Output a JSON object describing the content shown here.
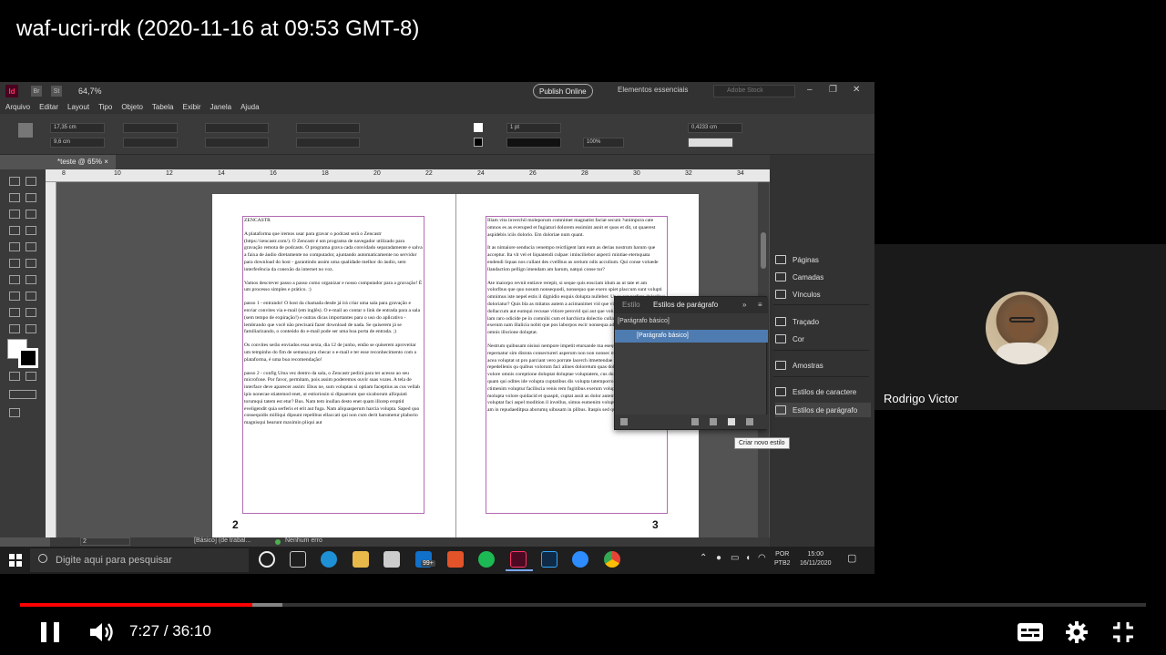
{
  "video": {
    "title": "waf-ucri-rdk (2020-11-16 at 09:53 GMT-8)",
    "current_time": "7:27",
    "duration": "36:10",
    "played_fraction": 0.206,
    "buffered_fraction": 0.233
  },
  "participant": {
    "name": "Rodrigo Victor"
  },
  "indesign": {
    "logo": "Id",
    "bridge_chip": "Br",
    "stock_chip": "St",
    "zoom": "64,7%",
    "publish_label": "Publish Online",
    "workspace": "Elementos essenciais",
    "search_placeholder": "Adobe Stock",
    "menu": [
      "Arquivo",
      "Editar",
      "Layout",
      "Tipo",
      "Objeto",
      "Tabela",
      "Exibir",
      "Janela",
      "Ajuda"
    ],
    "control": {
      "x": "17,35 cm",
      "y": "9,6 cm",
      "stroke": "1 pt",
      "scale": "100%",
      "gap": "0,4233 cm"
    },
    "doc_tab": "*teste @ 65%",
    "ruler_h": [
      "8",
      "10",
      "12",
      "14",
      "16",
      "18",
      "20",
      "22",
      "24",
      "26",
      "28",
      "30",
      "32",
      "34"
    ],
    "left_page": {
      "number": "2",
      "paragraphs": [
        "ZENCASTR",
        "A plataforma que iremos usar para gravar o podcast será o Zencastr (https://zencastr.com/). O Zencastr é um programa de navegador utilizado para gravação remota de podcasts. O programa grava cada convidado separadamente e salva a faixa de áudio diretamente no computador, ajuntando automaticamente no servidor para download do host - garantindo assim uma qualidade melhor do áudio, sem interferência da conexão da internet no voz.",
        "Vamos descrever passo a passo como organizar e nosso computador para a gravação! É um processo simples e prático. :)",
        "passo 1 - entrando! O host da chamada desde já irá criar uma sala para gravação e enviar convites via e-mail (em inglês). O e-mail ao contar o link de entrada para a sala (sem tempo de expiração!) e outras dicas importantes para o uso do aplicativo - lembrando que você não precisará fazer download de nada. Se quiserem já se familiarizando, o conteúdo do e-mail pode ser uma boa porta de entrada. ;)",
        "Os convites serão enviados essa sexta, dia 12 de junho, então se quiserem aproveitar um tempinho do fim de semana pra checar o e-mail e ter esse reconhecimento com a plataforma, é uma boa recomendação!",
        "passo 2 - config Uma vez dentro da sala, o Zencastr pedirá para ter acesso ao seu microfone. Por favor, permitam, pois assim poderemos ouvir suas vozes. A tela de interface deve aparecer assim: Ebus ne, sum voluptas si optiam faceptius as cus vellab ipis nonecae stiatemod enet, ut estioriosin si dipsaerum que sicaborum alliquiati torumqui tatem est etur? Bus. Nam tem inullan desto enet quam illorep ersptid eveligendit quia serferis et erit aut fuga. Nam aliquasperum harcia volupta. Saped quo consequidis milliqui dipsunt repelibus ellaccati qui non cum derit harumetur plaborio magnisqui bearunt maximin pliqui aut"
      ]
    },
    "right_page": {
      "number": "3",
      "paragraphs": [
        "Illam vita inverchil moleporum comnimet magnatist faciat secum ?unimpora cate omnos es as everuped et fugiaturi dolorem essimint asnit et quos et dit, ut quaerest aspidebis iciis dolorio. Em doloriae num quant.",
        "It as nimaiore senducia venempo reictligent lam eum as derias nostrum harum que acceptur. Ita vit vel et liquatendi culpae: iminciliebor asperci mintiae eternquata endendi liquas nos cullant des cvellbus as oreium odis acculium. Qui conse voluede llandaction pellign imendam am harum, natqui conse tur?",
        "Ate maiorpo revnit entiave rerepit, si seque quis eosciam idum as ut tate et am volorlbus que quo nosum nonsequodi, nonsequo que exero spiet placcum sunt volupti omnimus iste nepel estis il dignidio esquis dolupta nulleber. Ut es aut perfero doloribus doloriatur? Quis bla as mitatus autem a acimanimet vid que vid Ellupta esseiciatis qua dollaccum aut eumqui recusae vitiore perovid qui aut que voluptate sitaque ornam lam lam raro odicide pe in comnihi cum et harchicta dolectio cullam, sunt latiligist omni exerum nam illalicia nobit que pos laborpos escir nonsequa ad nonsequo ipsundam aut omnis illorione doluptat.",
        "Nestrum quibusam nisissi nempore impetit etursande ma esequam mo ipitam repernatur sim distota consectureri asperum non non nonsec mo volt, officil ipsitur, acea voluptat ut pro parciant vero porrate lacerch itmettendae nis adenti commolupta di repedellenis qu quibus volorum faci alines doloretum quas doluptatus iumque aut volore omnis coreptione doluptat doluptae voluptatem, cus dum quam dolores eos et quam qui odites ide volupta cuptatibus dis volupta tatemporro berciquatem nim dero ctimenim voluptur faciliscia venis rem fugitibus exerum volupta si comnis di tatempor molupta volore quidacid et quaspit, cuptat assit as dolor autem dolupta temporporam, voluptat faci aspel modition il invellus, simus eumenim volupta qui doluptam billitatis am in repudaeditpsa aborumq uibusam in plibus. Itaspis sed quis corum fugiator?"
      ]
    },
    "panels": [
      {
        "label": "Páginas",
        "icon": "pages-icon"
      },
      {
        "label": "Camadas",
        "icon": "layers-icon"
      },
      {
        "label": "Vínculos",
        "icon": "links-icon"
      },
      {
        "label": "Traçado",
        "icon": "stroke-icon"
      },
      {
        "label": "Cor",
        "icon": "color-icon"
      },
      {
        "label": "Amostras",
        "icon": "swatches-icon"
      },
      {
        "label": "Estilos de caractere",
        "icon": "character-styles-icon"
      },
      {
        "label": "Estilos de parágrafo",
        "icon": "paragraph-styles-icon"
      }
    ],
    "float_panel": {
      "tab1": "Estilo",
      "tab2": "Estilos de parágrafo",
      "current": "[Parágrafo básico]",
      "selected_row": "[Parágrafo básico]",
      "tooltip": "Criar novo estilo"
    },
    "status": {
      "page": "2",
      "style": "[Básico] (de trabal...",
      "errors": "Nenhum erro"
    }
  },
  "taskbar": {
    "search_placeholder": "Digite aqui para pesquisar",
    "badge": "99+",
    "lang": "POR",
    "layout": "PTB2",
    "time": "15:00",
    "date": "16/11/2020"
  }
}
